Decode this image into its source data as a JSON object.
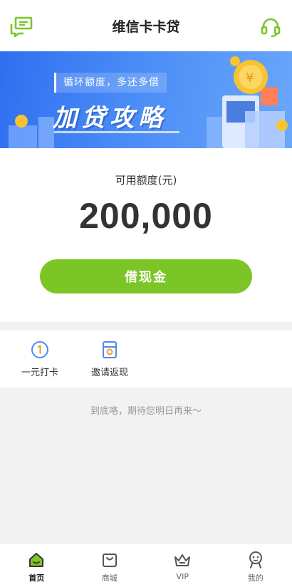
{
  "header": {
    "title": "维信卡卡贷"
  },
  "banner": {
    "tag": "循环额度，多还多借",
    "headline": "加贷攻略"
  },
  "credit": {
    "label": "可用额度(元)",
    "amount": "200,000",
    "button": "借现金"
  },
  "shortcuts": [
    {
      "label": "一元打卡",
      "icon": "one-coin-icon"
    },
    {
      "label": "邀请返现",
      "icon": "invite-card-icon"
    }
  ],
  "note": "到底咯，期待您明日再来～",
  "tabs": [
    {
      "label": "首页",
      "icon": "home-icon",
      "active": true
    },
    {
      "label": "商城",
      "icon": "shop-bag-icon",
      "active": false
    },
    {
      "label": "VIP",
      "icon": "crown-icon",
      "active": false
    },
    {
      "label": "我的",
      "icon": "profile-icon",
      "active": false
    }
  ],
  "colors": {
    "accent": "#7bc626",
    "banner": "#3a7ef2"
  }
}
